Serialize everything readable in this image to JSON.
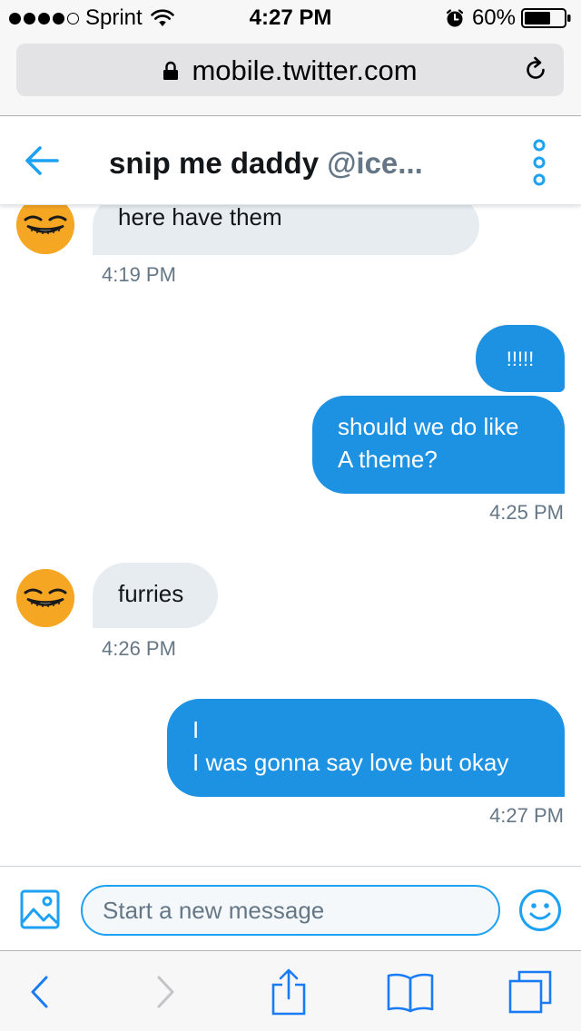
{
  "status_bar": {
    "carrier": "Sprint",
    "time": "4:27 PM",
    "battery": "60%",
    "signal_bars_filled": 4,
    "signal_bars_total": 5
  },
  "browser": {
    "url": "mobile.twitter.com"
  },
  "conversation_header": {
    "name": "snip me daddy",
    "handle": "@ice..."
  },
  "messages": [
    {
      "direction": "incoming",
      "text": "here have them",
      "time": "4:19 PM"
    },
    {
      "direction": "outgoing",
      "text": "!!!!!"
    },
    {
      "direction": "outgoing",
      "text": "should we do like\nA theme?",
      "time": "4:25 PM"
    },
    {
      "direction": "incoming",
      "text": "furries",
      "time": "4:26 PM"
    },
    {
      "direction": "outgoing",
      "text": "I\nI was gonna say love but okay",
      "time": "4:27 PM"
    }
  ],
  "composer": {
    "placeholder": "Start a new message"
  },
  "icons": {
    "back": "arrow-left-icon",
    "more": "more-vertical-icon",
    "media": "image-icon",
    "emoji": "smiley-icon",
    "lock": "lock-icon",
    "reload": "reload-icon",
    "browser_back": "chevron-left-icon",
    "browser_forward": "chevron-right-icon",
    "share": "share-icon",
    "bookmarks": "book-icon",
    "tabs": "tabs-icon"
  },
  "colors": {
    "accent": "#1da1f2",
    "outgoing_bubble": "#1d91e2",
    "incoming_bubble": "#e6ecf0",
    "timestamp": "#657786",
    "avatar": "#f5a623"
  }
}
